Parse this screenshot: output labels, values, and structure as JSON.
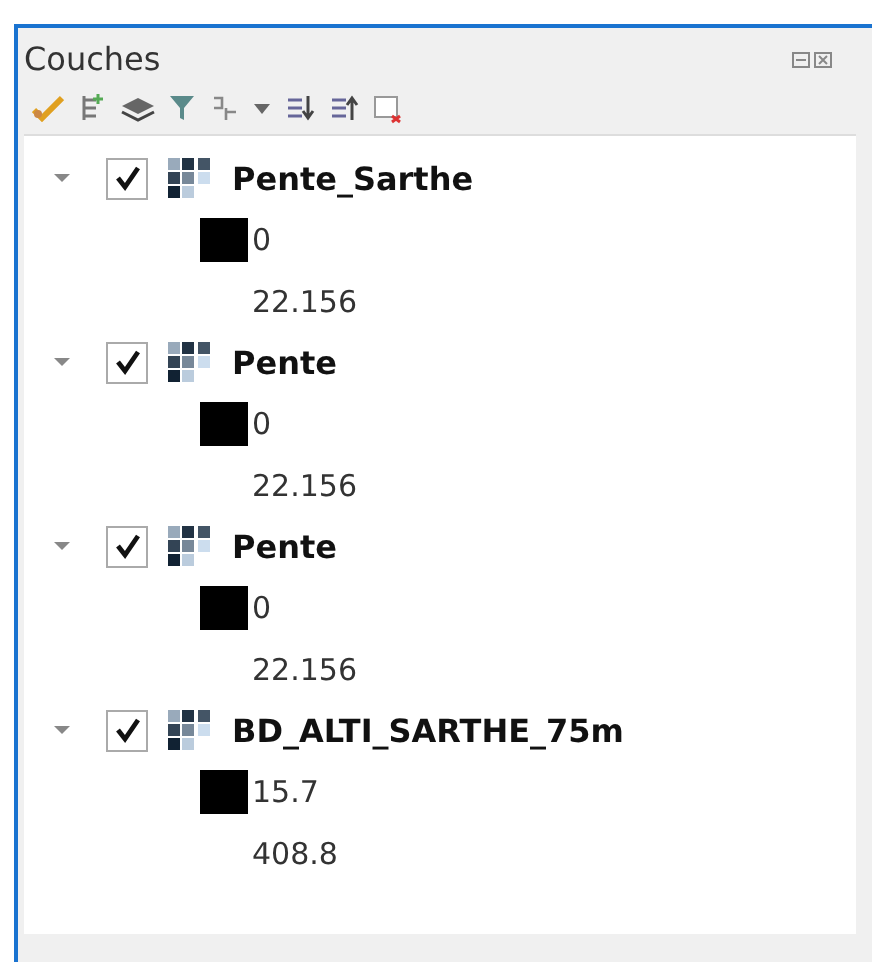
{
  "panel": {
    "title": "Couches"
  },
  "layers": [
    {
      "name": "Pente_Sarthe",
      "expanded": true,
      "checked": true,
      "legend": {
        "min": "0",
        "max": "22.156"
      }
    },
    {
      "name": "Pente",
      "expanded": true,
      "checked": true,
      "legend": {
        "min": "0",
        "max": "22.156"
      }
    },
    {
      "name": "Pente",
      "expanded": true,
      "checked": true,
      "legend": {
        "min": "0",
        "max": "22.156"
      }
    },
    {
      "name": "BD_ALTI_SARTHE_75m",
      "expanded": true,
      "checked": true,
      "legend": {
        "min": "15.7",
        "max": "408.8"
      }
    }
  ]
}
